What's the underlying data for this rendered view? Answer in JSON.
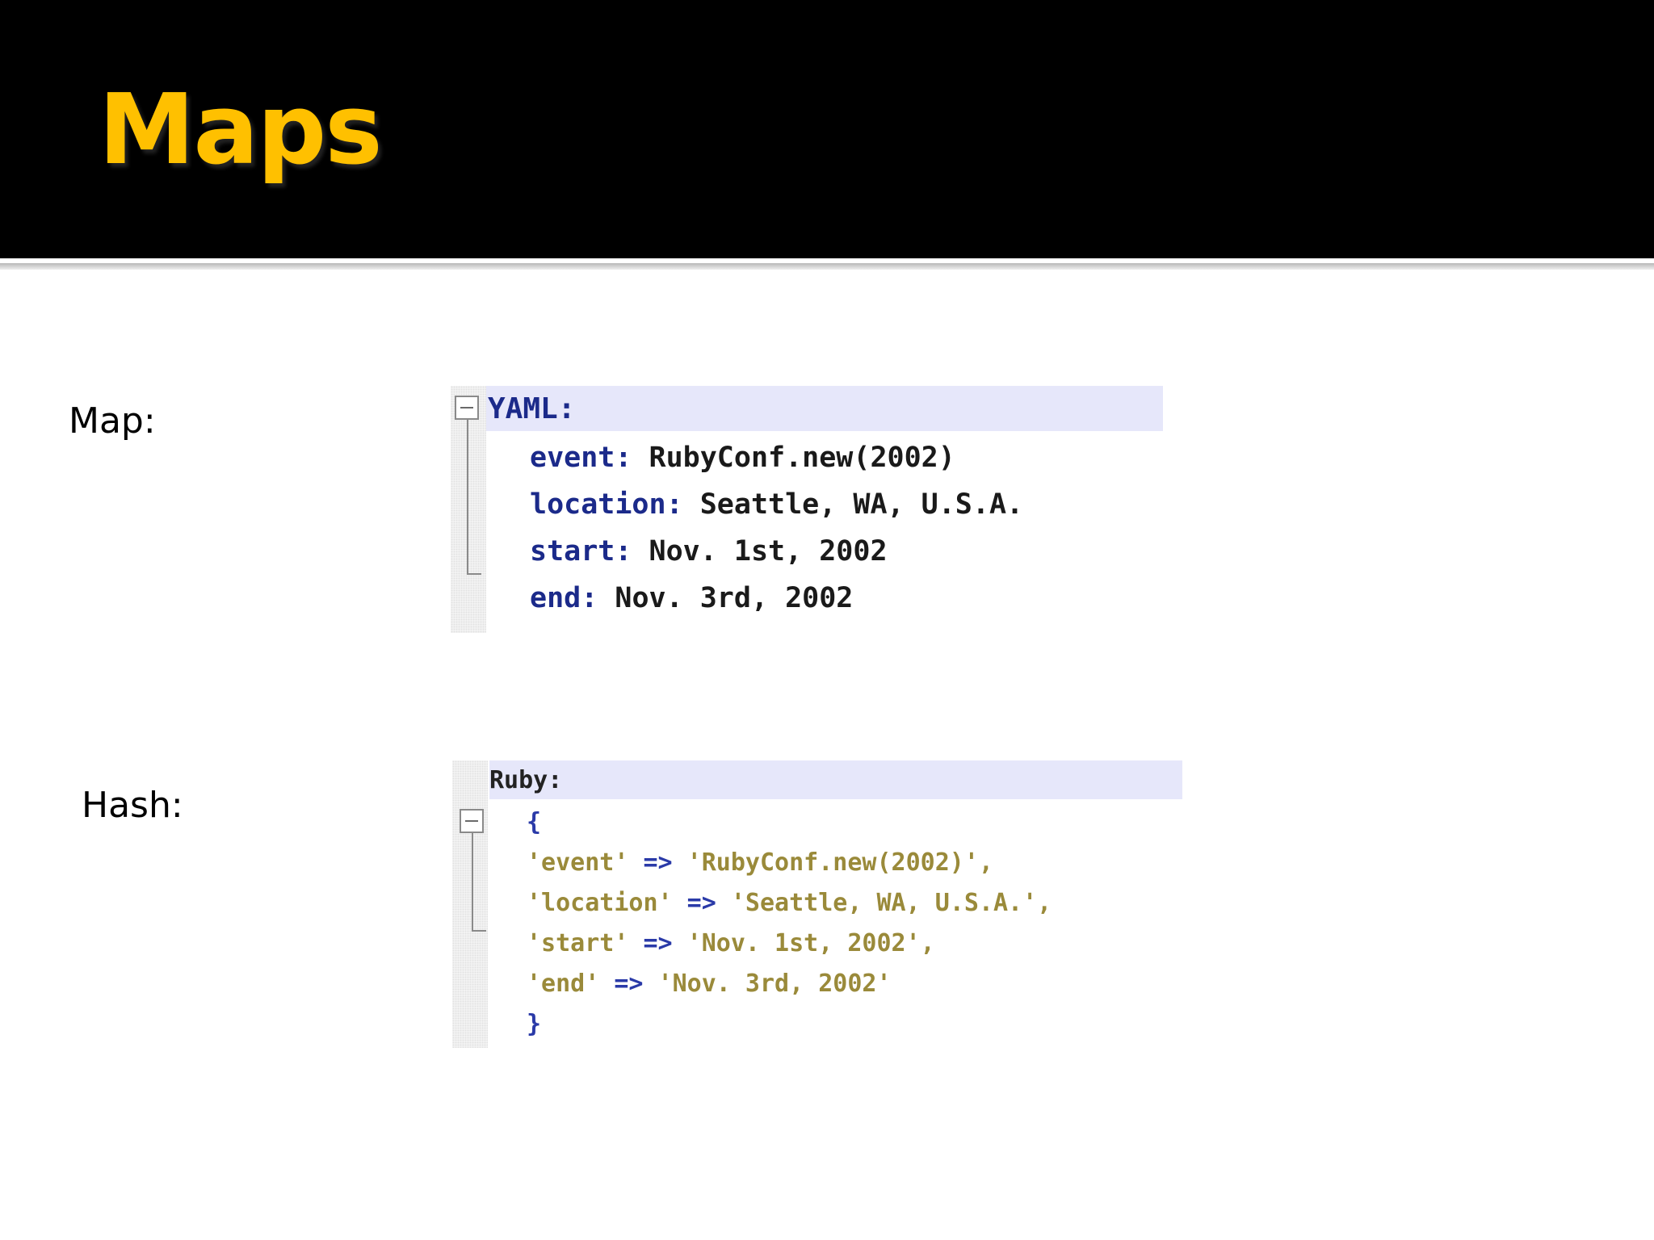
{
  "slide": {
    "title": "Maps",
    "map_label": "Map:",
    "hash_label": "Hash:"
  },
  "yaml": {
    "header": "YAML:",
    "lines": [
      {
        "key": "event:",
        "value": " RubyConf.new(2002)"
      },
      {
        "key": "location:",
        "value": " Seattle, WA, U.S.A."
      },
      {
        "key": "start:",
        "value": " Nov. 1st, 2002"
      },
      {
        "key": "end:",
        "value": " Nov. 3rd, 2002"
      }
    ]
  },
  "ruby": {
    "header": "Ruby:",
    "open_brace": "{",
    "close_brace": "}",
    "lines": [
      {
        "key": "'event'",
        "op": " => ",
        "value": "'RubyConf.new(2002)',"
      },
      {
        "key": "'location'",
        "op": " => ",
        "value": "'Seattle, WA, U.S.A.',"
      },
      {
        "key": "'start'",
        "op": " => ",
        "value": "'Nov. 1st, 2002',"
      },
      {
        "key": "'end'",
        "op": " => ",
        "value": "'Nov. 3rd, 2002'"
      }
    ]
  },
  "colors": {
    "title": "#ffc000",
    "title_bar": "#000000",
    "yaml_key": "#1b2a8a",
    "ruby_string": "#9a8a3a",
    "ruby_operator": "#2a3aa8",
    "code_header_band": "#e6e7fa"
  },
  "icons": {
    "fold": "collapse-minus-icon"
  }
}
